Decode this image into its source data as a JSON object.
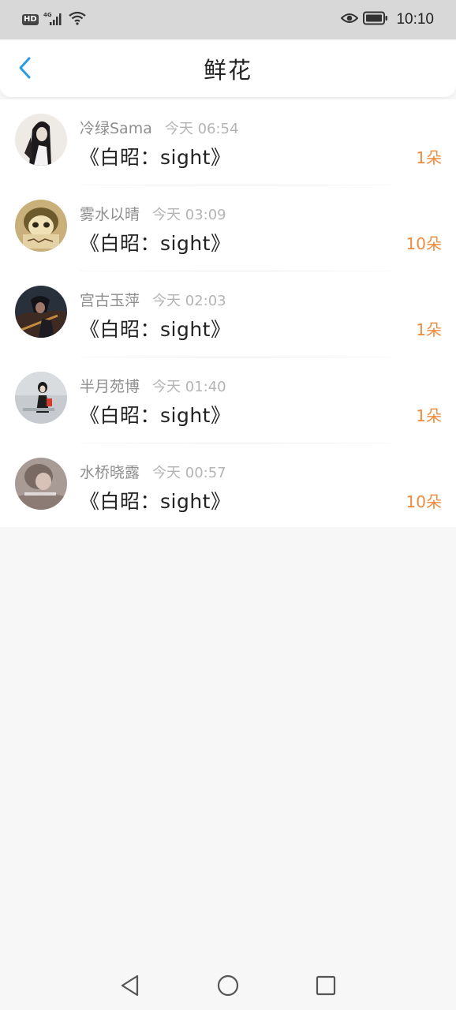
{
  "status_bar": {
    "hd": "HD",
    "network": "4G",
    "time": "10:10"
  },
  "header": {
    "title": "鲜花",
    "back_icon": "chevron-left-icon"
  },
  "items": [
    {
      "name": "冷绿Sama",
      "time": "今天 06:54",
      "book": "《白昭：sight》",
      "count": "1朵"
    },
    {
      "name": "雾水以晴",
      "time": "今天 03:09",
      "book": "《白昭：sight》",
      "count": "10朵"
    },
    {
      "name": "宫古玉萍",
      "time": "今天 02:03",
      "book": "《白昭：sight》",
      "count": "1朵"
    },
    {
      "name": "半月苑博",
      "time": "今天 01:40",
      "book": "《白昭：sight》",
      "count": "1朵"
    },
    {
      "name": "水桥晓露",
      "time": "今天 00:57",
      "book": "《白昭：sight》",
      "count": "10朵"
    }
  ],
  "colors": {
    "accent": "#2c9be0",
    "count": "#f08a3c",
    "status_bar_bg": "#d8d8d8"
  },
  "system_nav": [
    "back-triangle-icon",
    "home-circle-icon",
    "recents-square-icon"
  ]
}
